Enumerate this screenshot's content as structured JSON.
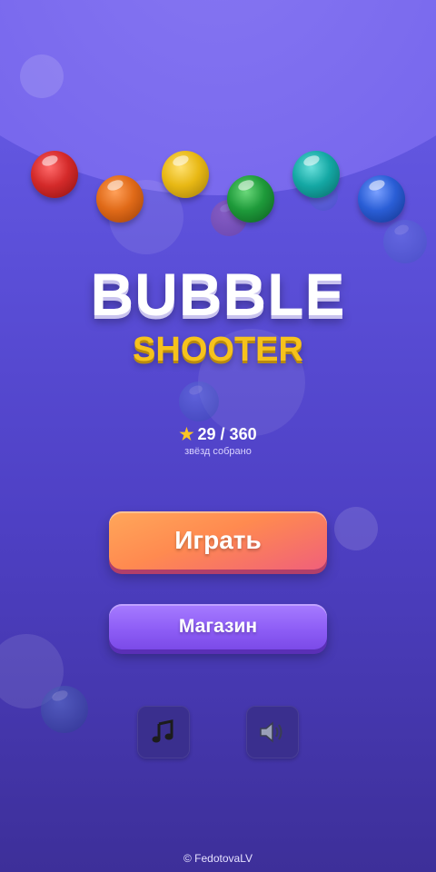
{
  "title": {
    "line1": "BUBBLE",
    "line2": "SHOOTER"
  },
  "stars": {
    "icon": "star-icon",
    "count": "29 / 360",
    "caption": "звёзд собрано"
  },
  "buttons": {
    "play": "Играть",
    "shop": "Магазин"
  },
  "toggles": {
    "music_icon": "music-note-icon",
    "sound_icon": "speaker-icon"
  },
  "footer": {
    "copyright": "© FedotovaLV"
  },
  "colors": {
    "background_top": "#6a5ee8",
    "background_bottom": "#3d2f99",
    "title_white": "#ffffff",
    "title_yellow": "#f6c21c",
    "play_button": "#ff8a50",
    "shop_button": "#8e5ef6",
    "bubble_red": "#d42a2a",
    "bubble_orange": "#e06a18",
    "bubble_yellow": "#e8b814",
    "bubble_green": "#1e9a3a",
    "bubble_teal": "#14a8a4",
    "bubble_blue": "#2a5ed6"
  }
}
